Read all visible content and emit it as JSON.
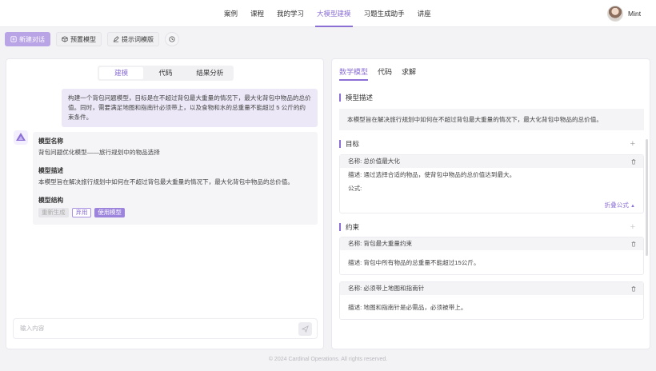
{
  "nav": {
    "items": [
      {
        "label": "案例",
        "active": false
      },
      {
        "label": "课程",
        "active": false
      },
      {
        "label": "我的学习",
        "active": false
      },
      {
        "label": "大模型建模",
        "active": true
      },
      {
        "label": "习题生成助手",
        "active": false
      },
      {
        "label": "讲座",
        "active": false
      }
    ],
    "username": "Mint"
  },
  "toolbar": {
    "new_chat": "新建对话",
    "preset_model": "预置模型",
    "prompt_template": "提示词模版"
  },
  "left": {
    "tabs": [
      {
        "label": "建模",
        "active": true
      },
      {
        "label": "代码",
        "active": false
      },
      {
        "label": "结果分析",
        "active": false
      }
    ],
    "user_message": "构建一个背包问题模型，目标是在不超过背包最大重量的情况下，最大化背包中物品的总价值。同时，需要满足地图和指南针必须带上，以及食物和水的总重量不能超过 5 公斤的约束条件。",
    "bot": {
      "name_heading": "模型名称",
      "name_text": "背包问题优化模型——旅行规划中的物品选择",
      "desc_heading": "模型描述",
      "desc_text": "本模型旨在解决旅行规划中如何在不超过背包最大重量的情况下，最大化背包中物品的总价值。",
      "struct_heading": "模型结构",
      "regenerate": "重新生成",
      "discard": "弃用",
      "use_model": "使用模型"
    },
    "input_placeholder": "输入内容"
  },
  "right": {
    "tabs": [
      {
        "label": "数学模型",
        "active": true
      },
      {
        "label": "代码",
        "active": false
      },
      {
        "label": "求解",
        "active": false
      }
    ],
    "model_desc_title": "模型描述",
    "model_desc_text": "本模型旨在解决旅行规划中如何在不超过背包最大重量的情况下，最大化背包中物品的总价值。",
    "objective_title": "目标",
    "objective": {
      "name": "名称:  总价值最大化",
      "desc": "描述:  通过选择合适的物品，使背包中物品的总价值达到最大。",
      "formula": "公式:",
      "fold": "折叠公式"
    },
    "constraints_title": "约束",
    "constraints": [
      {
        "name": "名称:  背包最大重量约束",
        "desc": "描述:  背包中所有物品的总重量不能超过15公斤。"
      },
      {
        "name": "名称:  必须带上地图和指南针",
        "desc": "描述:  地图和指南针是必需品，必须被带上。"
      }
    ]
  },
  "footer": "© 2024 Cardinal Operations. All rights reserved.",
  "colors": {
    "accent": "#8b6fd4",
    "accent_light": "#ece8f7"
  }
}
